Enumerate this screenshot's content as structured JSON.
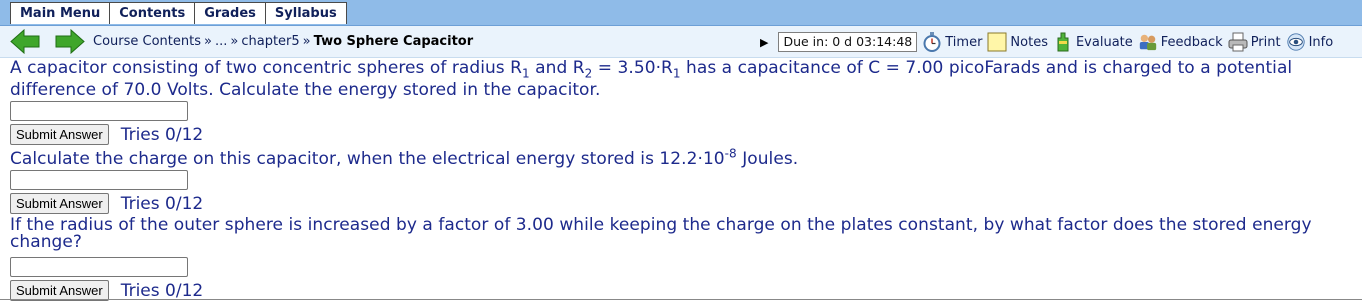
{
  "menu": {
    "tabs": [
      "Main Menu",
      "Contents",
      "Grades",
      "Syllabus"
    ]
  },
  "nav": {
    "back_icon": "green-left-arrow-icon",
    "forward_icon": "green-right-arrow-icon",
    "breadcrumb": {
      "course_contents": "Course Contents",
      "ellipsis": "...",
      "chapter": "chapter5",
      "current": "Two Sphere Capacitor",
      "separator": "»"
    },
    "due": "Due in: 0 d 03:14:48",
    "tools": {
      "timer": "Timer",
      "notes": "Notes",
      "evaluate": "Evaluate",
      "feedback": "Feedback",
      "print": "Print",
      "info": "Info"
    }
  },
  "questions": [
    {
      "t1": "A capacitor consisting of two concentric spheres of radius R",
      "s1": "1",
      "t2": " and R",
      "s2": "2",
      "t3": " = 3.50·R",
      "s3": "1",
      "t4": " has a capacitance of C = 7.00 picoFarads and is charged to a potential difference of 70.0 Volts. Calculate the energy stored in the capacitor.",
      "input_value": "",
      "submit_label": "Submit Answer",
      "tries": "Tries 0/12"
    },
    {
      "t1": "Calculate the charge on this capacitor, when the electrical energy stored is 12.2·10",
      "sup": "-8",
      "t2": " Joules.",
      "input_value": "",
      "submit_label": "Submit Answer",
      "tries": "Tries 0/12"
    },
    {
      "t1": "If the radius of the outer sphere is increased by a factor of 3.00 while keeping the charge on the plates constant, by what factor does the stored energy change?",
      "input_value": "",
      "submit_label": "Submit Answer",
      "tries": "Tries 0/12"
    }
  ]
}
